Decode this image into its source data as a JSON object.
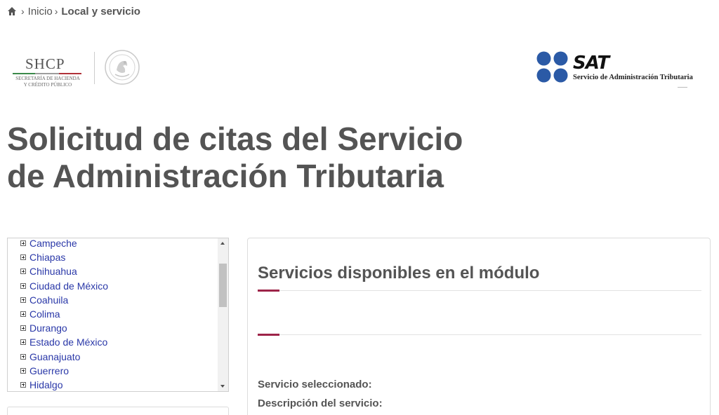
{
  "breadcrumb": {
    "home_icon": "home-icon",
    "items": [
      {
        "label": "Inicio",
        "link": true
      },
      {
        "label": "Local y servicio",
        "link": false
      }
    ],
    "separator_icon": "chevron-right-icon"
  },
  "logos": {
    "shcp": {
      "word": "SHCP",
      "subtitle_line1": "SECRETARÍA DE HACIENDA",
      "subtitle_line2": "Y CRÉDITO PÚBLICO",
      "seal_icon": "mexican-coat-of-arms-icon"
    },
    "sat": {
      "word": "SAT",
      "subtitle": "Servicio de Administración Tributaria",
      "dots_color": "#2b5aa6"
    }
  },
  "page": {
    "title": "Solicitud de citas del Servicio de Administración Tributaria"
  },
  "states": {
    "items": [
      "Campeche",
      "Chiapas",
      "Chihuahua",
      "Ciudad de México",
      "Coahuila",
      "Colima",
      "Durango",
      "Estado de México",
      "Guanajuato",
      "Guerrero",
      "Hidalgo"
    ],
    "expand_icon": "plus-box-icon"
  },
  "services": {
    "title": "Servicios disponibles en el módulo",
    "selected_label": "Servicio seleccionado:",
    "description_label": "Descripción del servicio:"
  },
  "colors": {
    "text": "#545454",
    "link": "#2a38a8",
    "accent": "#9d2449",
    "sat_blue": "#2b5aa6"
  }
}
